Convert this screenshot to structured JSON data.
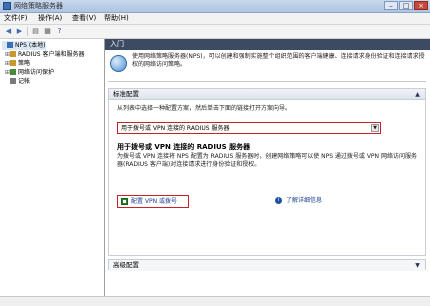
{
  "window": {
    "title": "网络策略服务器"
  },
  "menu": [
    "文件(F)",
    "操作(A)",
    "查看(V)",
    "帮助(H)"
  ],
  "tree": [
    {
      "label": "NPS (本地)",
      "expander": "",
      "color": "#3a6fb8"
    },
    {
      "label": "RADIUS 客户端和服务器",
      "expander": "⊞",
      "color": "#c89a2b"
    },
    {
      "label": "策略",
      "expander": "⊞",
      "color": "#c89a2b"
    },
    {
      "label": "网络访问保护",
      "expander": "⊞",
      "color": "#4a8a3a"
    },
    {
      "label": "记帐",
      "expander": "",
      "color": "#7a7a7a"
    }
  ],
  "main": {
    "header": "入门",
    "intro": "使用网络策略服务器(NPS)，可以创建和强制实施整个组织范围的客户端健康、连接请求身份验证和连接请求授权的网络访问策略。",
    "standard": {
      "title": "标准配置",
      "desc": "从列表中选择一种配置方案，然后单击下面的链接打开方案向导。",
      "selected": "用于拨号或 VPN 连接的 RADIUS 服务器",
      "heading": "用于拨号或 VPN 连接的 RADIUS 服务器",
      "body": "为拨号或 VPN 连接将 NPS 配置为 RADIUS 服务器时，创建网络策略可以使 NPS 通过拨号或 VPN 网络访问服务器(RADIUS 客户端)对连接请求进行身份验证和授权。",
      "action": "配置 VPN 或拨号",
      "more": "了解详细信息"
    },
    "advanced": {
      "title": "高级配置"
    }
  },
  "colors": {
    "header": "#3c4b62",
    "highlight": "#c7222a",
    "link": "#1a3d8f"
  }
}
